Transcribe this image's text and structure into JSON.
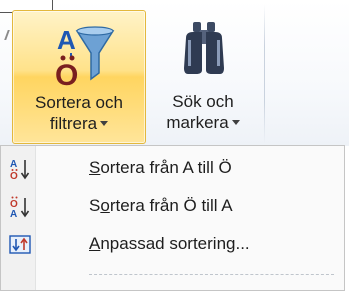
{
  "ribbon": {
    "sort_filter": {
      "label_line1": "Sortera och",
      "label_line2": "filtrera",
      "icon": "sort-filter-funnel-icon"
    },
    "find_select": {
      "label_line1": "Sök och",
      "label_line2": "markera",
      "icon": "binoculars-icon"
    }
  },
  "menu": {
    "items": [
      {
        "hotkey": "S",
        "rest": "ortera från A till Ö",
        "icon": "sort-a-to-o-icon"
      },
      {
        "pre": "S",
        "hotkey": "o",
        "rest": "rtera från Ö till A",
        "icon": "sort-o-to-a-icon"
      },
      {
        "hotkey": "A",
        "rest": "npassad sortering...",
        "icon": "custom-sort-icon"
      }
    ]
  },
  "colors": {
    "active_button_border": "#e3b83d",
    "active_button_fill": "#ffe28a",
    "funnel": "#5a8fc4",
    "sort_icon_blue": "#1f57b3",
    "sort_icon_red": "#c0392b"
  }
}
